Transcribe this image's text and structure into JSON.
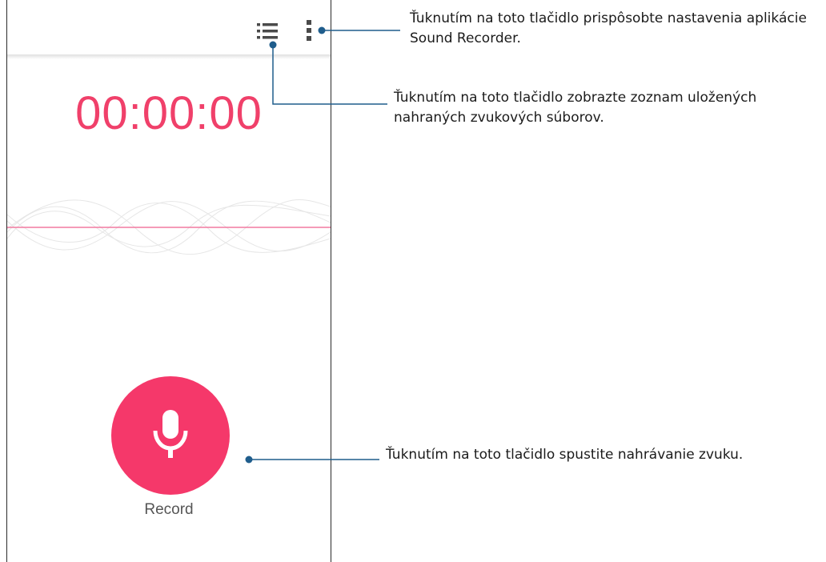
{
  "timer": {
    "value": "00:00:00"
  },
  "record": {
    "label": "Record"
  },
  "toolbar": {
    "list_icon": "list-icon",
    "more_icon": "more-vert-icon"
  },
  "callouts": {
    "settings": "Ťuknutím na toto tlačidlo prispôsobte nastavenia aplikácie Sound Recorder.",
    "list": "Ťuknutím na toto tlačidlo zobrazte zoznam uložených nahraných zvukových súborov.",
    "record": "Ťuknutím na toto tlačidlo spustite nahrávanie zvuku."
  },
  "colors": {
    "accent": "#f5386a",
    "timer": "#f0406a",
    "leader": "#1f5d8c"
  }
}
